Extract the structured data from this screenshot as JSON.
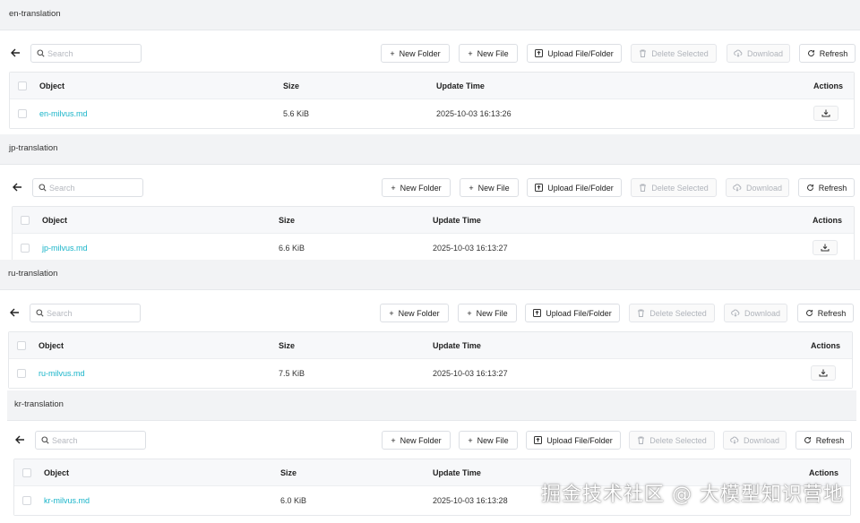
{
  "panels": [
    {
      "title": "en-translation",
      "search_placeholder": "Search",
      "buttons": {
        "new_folder": "New Folder",
        "new_file": "New File",
        "upload": "Upload File/Folder",
        "delete": "Delete Selected",
        "download": "Download",
        "refresh": "Refresh"
      },
      "columns": {
        "object": "Object",
        "size": "Size",
        "update_time": "Update Time",
        "actions": "Actions"
      },
      "row": {
        "name": "en-milvus.md",
        "size": "5.6 KiB",
        "time": "2025-10-03 16:13:26"
      }
    },
    {
      "title": "jp-translation",
      "search_placeholder": "Search",
      "buttons": {
        "new_folder": "New Folder",
        "new_file": "New File",
        "upload": "Upload File/Folder",
        "delete": "Delete Selected",
        "download": "Download",
        "refresh": "Refresh"
      },
      "columns": {
        "object": "Object",
        "size": "Size",
        "update_time": "Update Time",
        "actions": "Actions"
      },
      "row": {
        "name": "jp-milvus.md",
        "size": "6.6 KiB",
        "time": "2025-10-03 16:13:27"
      }
    },
    {
      "title": "ru-translation",
      "search_placeholder": "Search",
      "buttons": {
        "new_folder": "New Folder",
        "new_file": "New File",
        "upload": "Upload File/Folder",
        "delete": "Delete Selected",
        "download": "Download",
        "refresh": "Refresh"
      },
      "columns": {
        "object": "Object",
        "size": "Size",
        "update_time": "Update Time",
        "actions": "Actions"
      },
      "row": {
        "name": "ru-milvus.md",
        "size": "7.5 KiB",
        "time": "2025-10-03 16:13:27"
      }
    },
    {
      "title": "kr-translation",
      "search_placeholder": "Search",
      "buttons": {
        "new_folder": "New Folder",
        "new_file": "New File",
        "upload": "Upload File/Folder",
        "delete": "Delete Selected",
        "download": "Download",
        "refresh": "Refresh"
      },
      "columns": {
        "object": "Object",
        "size": "Size",
        "update_time": "Update Time",
        "actions": "Actions"
      },
      "row": {
        "name": "kr-milvus.md",
        "size": "6.0 KiB",
        "time": "2025-10-03 16:13:28"
      }
    }
  ],
  "watermark": "掘金技术社区 @ 大模型知识营地",
  "colors": {
    "link": "#18b4c9",
    "header_bg": "#f2f3f5",
    "disabled_text": "#b0b4bb"
  }
}
